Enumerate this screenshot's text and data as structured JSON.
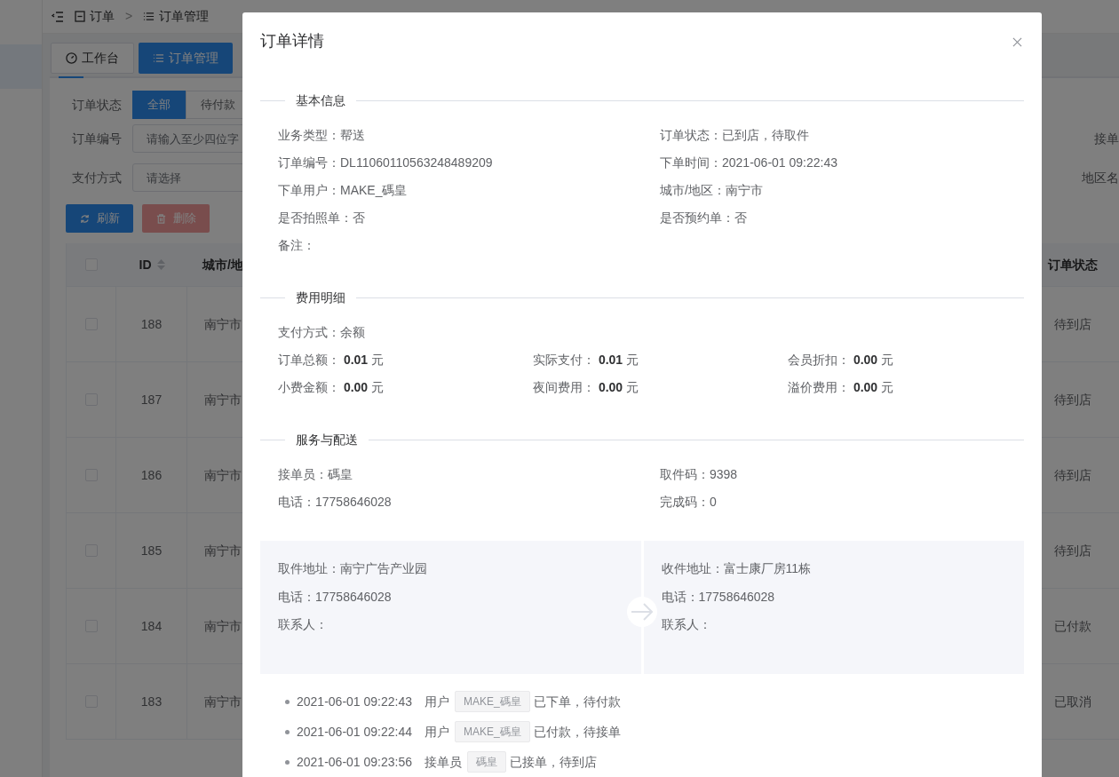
{
  "breadcrumb": [
    {
      "label": "订单"
    },
    {
      "label": "订单管理"
    }
  ],
  "breadcrumb_separator": ">",
  "tabs": [
    {
      "label": "工作台",
      "selected": false
    },
    {
      "label": "订单管理",
      "selected": true
    }
  ],
  "filters": {
    "status_label": "订单状态",
    "status_options": [
      {
        "label": "全部",
        "selected": true
      },
      {
        "label": "待付款",
        "selected": false
      }
    ],
    "order_no": {
      "label": "订单编号",
      "placeholder": "请输入至少四位字"
    },
    "payment": {
      "label": "支付方式",
      "placeholder": "请选择"
    },
    "right_labels": [
      "接单",
      "地区名"
    ]
  },
  "actions": [
    {
      "label": "刷新",
      "kind": "refresh",
      "disabled": false
    },
    {
      "label": "删除",
      "kind": "delete",
      "disabled": true
    }
  ],
  "table": {
    "all_checked": false,
    "columns": [
      "ID",
      "城市/地",
      "订单状态"
    ],
    "rows": [
      {
        "checked": false,
        "id": "188",
        "city": "南宁市",
        "status": "待到店"
      },
      {
        "checked": false,
        "id": "187",
        "city": "南宁市",
        "status": "待到店"
      },
      {
        "checked": false,
        "id": "186",
        "city": "南宁市",
        "status": "待到店"
      },
      {
        "checked": false,
        "id": "185",
        "city": "南宁市",
        "status": "待到店"
      },
      {
        "checked": false,
        "id": "184",
        "city": "南宁市",
        "status": "已付款"
      },
      {
        "checked": false,
        "id": "183",
        "city": "南宁市",
        "status": "已取消"
      }
    ]
  },
  "modal": {
    "title": "订单详情",
    "sections": [
      {
        "title": "基本信息",
        "kind": "two",
        "fields": [
          {
            "text": "业务类型：帮送"
          },
          {
            "text": "订单状态：已到店，待取件"
          },
          {
            "text": "订单编号：DL11060110563248489209"
          },
          {
            "text": "下单时间：2021-06-01 09:22:43"
          },
          {
            "text": "下单用户：MAKE_碼皇"
          },
          {
            "text": "城市/地区：南宁市"
          },
          {
            "text": "是否拍照单：否"
          },
          {
            "text": "是否预约单：否"
          },
          {
            "text": "备注："
          }
        ]
      },
      {
        "title": "费用明细",
        "kind": "three",
        "summary": "支付方式：余额",
        "fields": [
          {
            "text": "订单总额： **0.01** 元"
          },
          {
            "text": "实际支付： **0.01** 元"
          },
          {
            "text": "会员折扣： **0.00** 元"
          },
          {
            "text": "小费金额： **0.00** 元"
          },
          {
            "text": "夜间费用： **0.00** 元"
          },
          {
            "text": "溢价费用： **0.00** 元"
          }
        ]
      },
      {
        "title": "服务与配送",
        "kind": "two",
        "fields": [
          {
            "text": "接单员：碼皇"
          },
          {
            "text": "取件码：9398"
          },
          {
            "text": "电话：17758646028"
          },
          {
            "text": "完成码：0"
          }
        ]
      }
    ],
    "addresses": [
      {
        "lines": [
          "取件地址：南宁广告产业园",
          "电话：17758646028",
          "联系人："
        ]
      },
      {
        "lines": [
          "收件地址：富士康厂房11栋",
          "电话：17758646028",
          "联系人："
        ]
      }
    ],
    "timeline": [
      {
        "time": "2021-06-01 09:22:43",
        "actor": "用户",
        "tag": "MAKE_碼皇",
        "action": "已下单，待付款"
      },
      {
        "time": "2021-06-01 09:22:44",
        "actor": "用户",
        "tag": "MAKE_碼皇",
        "action": "已付款，待接单"
      },
      {
        "time": "2021-06-01 09:23:56",
        "actor": "接单员",
        "tag": "碼皇",
        "action": "已接单，待到店"
      }
    ]
  }
}
